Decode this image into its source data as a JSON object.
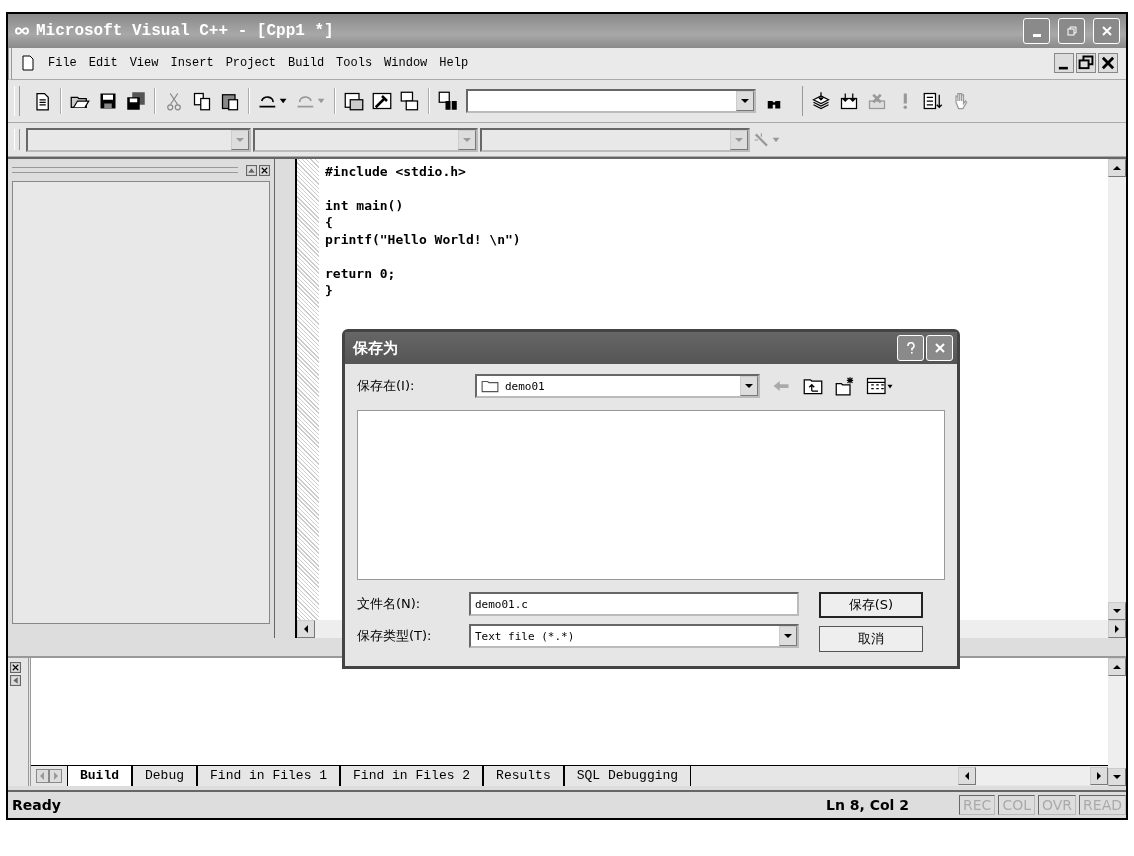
{
  "window": {
    "title": "Microsoft Visual C++ - [Cpp1 *]"
  },
  "menu": [
    {
      "label": "File"
    },
    {
      "label": "Edit"
    },
    {
      "label": "View"
    },
    {
      "label": "Insert"
    },
    {
      "label": "Project"
    },
    {
      "label": "Build"
    },
    {
      "label": "Tools"
    },
    {
      "label": "Window"
    },
    {
      "label": "Help"
    }
  ],
  "editor": {
    "blocks": [
      [
        "#include <stdio.h>"
      ],
      [
        "int main()",
        "{",
        "printf(\"Hello World! \\n\")"
      ],
      [
        "return 0;",
        "}"
      ]
    ]
  },
  "dialog": {
    "title": "保存为",
    "look_in_label": "保存在(I):",
    "look_in_value": "demo01",
    "filename_label": "文件名(N):",
    "filename_value": "demo01.c",
    "filetype_label": "保存类型(T):",
    "filetype_value": "Text file (*.*)",
    "buttons": [
      "保存(S)",
      "取消"
    ]
  },
  "output_tabs": [
    {
      "label": "Build",
      "selected": true
    },
    {
      "label": "Debug",
      "selected": false
    },
    {
      "label": "Find in Files 1",
      "selected": false
    },
    {
      "label": "Find in Files 2",
      "selected": false
    },
    {
      "label": "Results",
      "selected": false
    },
    {
      "label": "SQL Debugging",
      "selected": false
    }
  ],
  "status_bar": {
    "message": "Ready",
    "position": "Ln 8, Col 2",
    "indicators": [
      {
        "label": "REC",
        "disabled": true
      },
      {
        "label": "COL",
        "disabled": true
      },
      {
        "label": "OVR",
        "disabled": true
      },
      {
        "label": "READ",
        "disabled": true
      }
    ]
  }
}
